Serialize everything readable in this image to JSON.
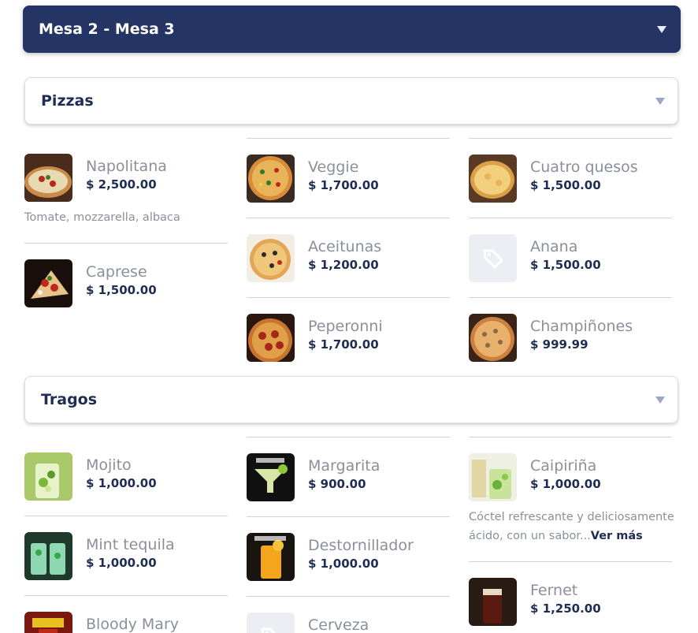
{
  "table_selector": {
    "label": "Mesa 2 - Mesa 3"
  },
  "categories": [
    {
      "name": "Pizzas",
      "items": [
        {
          "name": "Napolitana",
          "price": "$ 2,500.00",
          "description": "Tomate, mozzarella, albaca",
          "image": "pizza-napolitana"
        },
        {
          "name": "Caprese",
          "price": "$ 1,500.00",
          "image": "pizza-caprese"
        },
        {
          "name": "Veggie",
          "price": "$ 1,700.00",
          "image": "pizza-veggie"
        },
        {
          "name": "Aceitunas",
          "price": "$ 1,200.00",
          "image": "pizza-aceitunas"
        },
        {
          "name": "Peperonni",
          "price": "$ 1,700.00",
          "image": "pizza-peperonni"
        },
        {
          "name": "Cuatro quesos",
          "price": "$ 1,500.00",
          "image": "pizza-cuatro-quesos"
        },
        {
          "name": "Anana",
          "price": "$ 1,500.00",
          "image": "tag-icon"
        },
        {
          "name": "Champiñones",
          "price": "$ 999.99",
          "image": "pizza-champinones"
        }
      ]
    },
    {
      "name": "Tragos",
      "items": [
        {
          "name": "Mojito",
          "price": "$ 1,000.00",
          "image": "drink-mojito"
        },
        {
          "name": "Mint tequila",
          "price": "$ 1,000.00",
          "image": "drink-mint-tequila"
        },
        {
          "name": "Bloody Mary",
          "image": "drink-bloody-mary"
        },
        {
          "name": "Margarita",
          "price": "$ 900.00",
          "image": "drink-margarita"
        },
        {
          "name": "Destornillador",
          "price": "$ 1,000.00",
          "image": "drink-destornillador"
        },
        {
          "name": "Cerveza",
          "image": "tag-icon"
        },
        {
          "name": "Caipiriña",
          "price": "$ 1,000.00",
          "description": "Cóctel refrescante y deliciosamente ácido, con un sabor...",
          "more_label": "Ver más",
          "image": "drink-caipirina"
        },
        {
          "name": "Fernet",
          "price": "$ 1,250.00",
          "image": "drink-fernet"
        }
      ]
    }
  ],
  "colors": {
    "primary": "#243464",
    "muted_text": "#8a8f9a",
    "divider": "#cfd3db",
    "placeholder_bg": "#eceef3"
  }
}
